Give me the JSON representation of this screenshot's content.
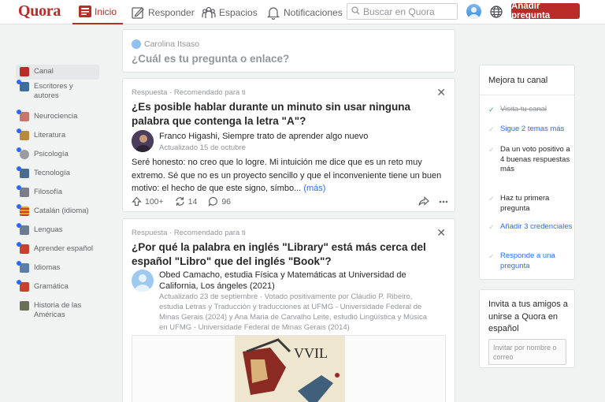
{
  "header": {
    "logo": "Quora",
    "nav": {
      "home": "Inicio",
      "answer": "Responder",
      "spaces": "Espacios",
      "notifications": "Notificaciones"
    },
    "search_placeholder": "Buscar en Quora",
    "add_question": "Añadir pregunta"
  },
  "sidebar": {
    "items": [
      {
        "label": "Canal",
        "icon": "feed-icon",
        "color": "#b92b27"
      },
      {
        "label": "Escritores y autores",
        "icon": "writers-icon",
        "color": "#3c6e9e"
      },
      {
        "label": "Neurociencia",
        "icon": "brain-icon",
        "color": "#c9766a"
      },
      {
        "label": "Literatura",
        "icon": "book-icon",
        "color": "#b88a3e"
      },
      {
        "label": "Psicología",
        "icon": "psychology-icon",
        "color": "#9a9aa0"
      },
      {
        "label": "Tecnología",
        "icon": "technology-icon",
        "color": "#4a6c8f"
      },
      {
        "label": "Filosofía",
        "icon": "philosophy-icon",
        "color": "#7a7e88"
      },
      {
        "label": "Catalán (idioma)",
        "icon": "catalan-flag-icon",
        "color": "#e2a41c"
      },
      {
        "label": "Lenguas",
        "icon": "languages-icon",
        "color": "#6c7d8f"
      },
      {
        "label": "Aprender español",
        "icon": "learn-spanish-icon",
        "color": "#c8412f"
      },
      {
        "label": "Idiomas",
        "icon": "idiomas-icon",
        "color": "#5a7fa8"
      },
      {
        "label": "Gramática",
        "icon": "grammar-icon",
        "color": "#c8412f"
      },
      {
        "label": "Historia de las Américas",
        "icon": "history-icon",
        "color": "#6a6f57"
      }
    ]
  },
  "ask": {
    "user": "Carolina Itsaso",
    "prompt": "¿Cuál es tu pregunta o enlace?"
  },
  "posts": [
    {
      "meta": "Respuesta · Recomendado para ti",
      "title": "¿Es posible hablar durante un minuto sin usar ninguna palabra que contenga la letra \"A\"?",
      "author": "Franco Higashi, Siempre trato de aprender algo nuevo",
      "updated": "Actualizado 15 de octubre",
      "body": "Seré honesto: no creo que lo logre. Mi intuición me dice que es un reto muy extremo. Sé que no es un proyecto sencillo y que el inconveniente tiene un buen motivo: el hecho de que este signo, símbo...",
      "more": "(más)",
      "upvotes": "100+",
      "shares": "14",
      "comments": "96"
    },
    {
      "meta": "Respuesta · Recomendado para ti",
      "title": "¿Por qué la palabra en inglés \"Library\" está más cerca del español \"Libro\" que del inglés \"Book\"?",
      "author": "Obed Camacho, estudia Física y Matemáticas at Universidad de California, Los ángeles (2021)",
      "updated": "Actualizado 23 de septiembre · Votado positivamente por Cláudio P. Ribeiro, estudia Letras y Traducción y traducciones at UFMG - Universidade Federal de Minas Gerais (2024) y Ana Maria de Carvalho Leite, estudió Lingüística y Música en UFMG - Universidade Federal de Minas Gerais (2014)",
      "image_caption": "VVIL"
    }
  ],
  "improve": {
    "title": "Mejora tu canal",
    "steps": [
      {
        "label": "Visita tu canal",
        "state": "done"
      },
      {
        "label": "Sigue 2 temas más",
        "state": "link"
      },
      {
        "label": "Da un voto positivo a 4 buenas respuestas más",
        "state": "todo"
      },
      {
        "label": "Haz tu primera pregunta",
        "state": "todo"
      },
      {
        "label": "Añadir 3 credenciales",
        "state": "link"
      },
      {
        "label": "Responde a una pregunta",
        "state": "link"
      }
    ]
  },
  "invite": {
    "text": "Invita a tus amigos a unirse a Quora en español",
    "placeholder": "Invitar por nombre o correo"
  },
  "colors": {
    "brand": "#b92b27",
    "link": "#2e69ff",
    "done": "#2ba84a"
  }
}
